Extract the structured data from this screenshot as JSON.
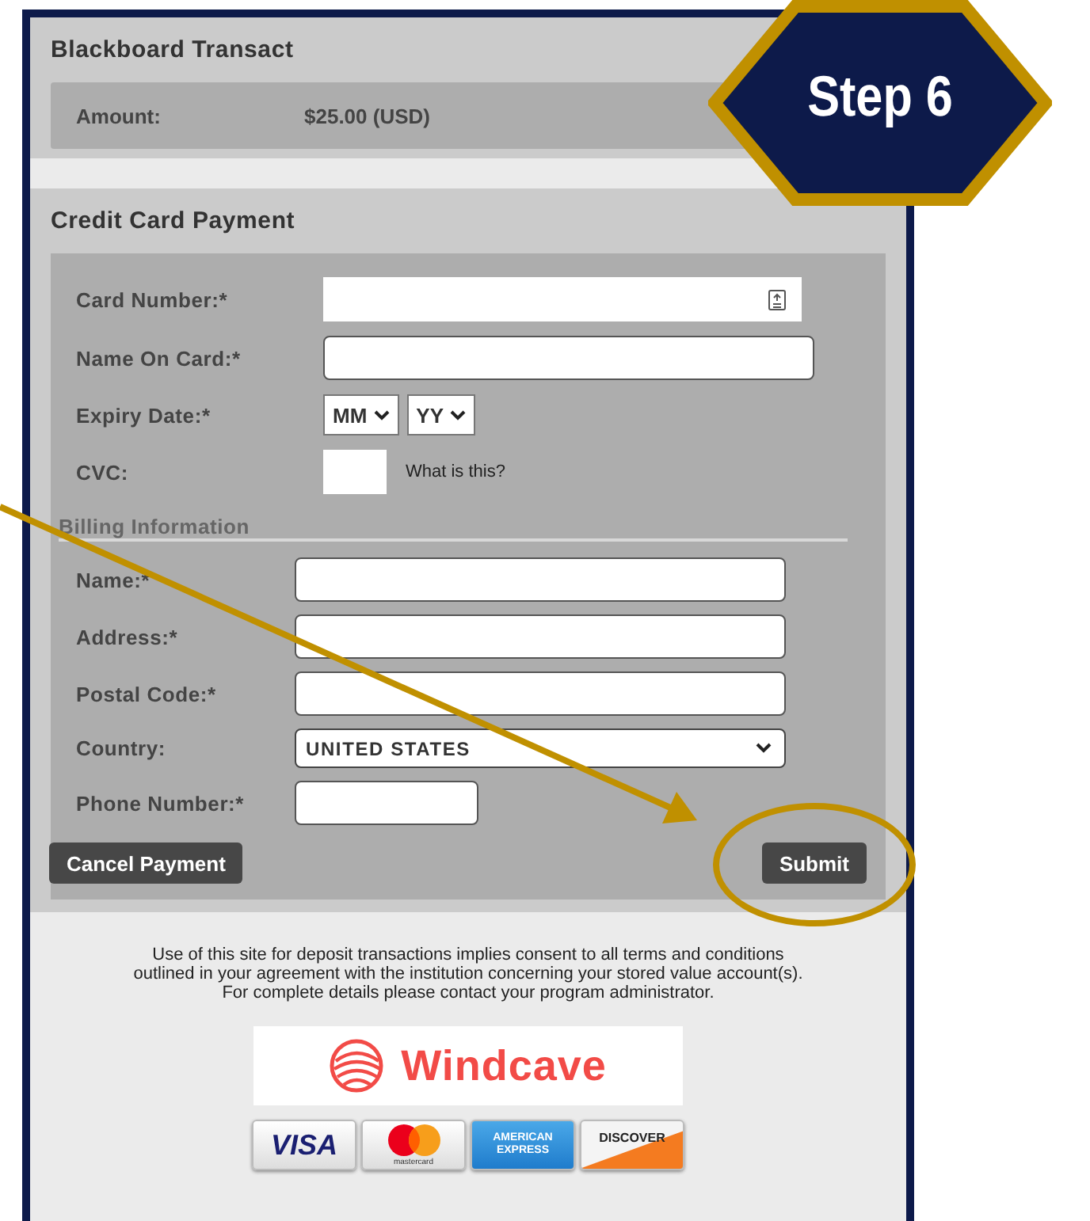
{
  "header": {
    "title": "Blackboard Transact",
    "amount_label": "Amount:",
    "amount": "$25.00 (USD)"
  },
  "step_badge": "Step 6",
  "payment": {
    "title": "Credit Card Payment",
    "card_fields": [
      {
        "label": "Card Number:*",
        "kind": "card"
      },
      {
        "label": "Name On Card:*",
        "kind": "text"
      },
      {
        "label": "Expiry Date:*",
        "kind": "expiry",
        "selects": [
          "MM",
          "YY"
        ]
      },
      {
        "label": "CVC:",
        "kind": "cvc",
        "help_link": "What is this?"
      }
    ],
    "billing": {
      "title": "Billing Information",
      "fields": [
        {
          "label": "Name:*",
          "kind": "text"
        },
        {
          "label": "Address:*",
          "kind": "text"
        },
        {
          "label": "Postal Code:*",
          "kind": "text"
        },
        {
          "label": "Country:",
          "kind": "select",
          "value": "UNITED STATES"
        },
        {
          "label": "Phone Number:*",
          "kind": "short"
        }
      ]
    },
    "buttons": [
      {
        "label": "Cancel Payment",
        "highlighted": false
      },
      {
        "label": "Submit",
        "highlighted": true
      }
    ]
  },
  "notice_lines": [
    "Use of this site for deposit transactions implies consent to all terms and conditions",
    "outlined in your agreement with the institution concerning your stored value account(s).",
    "For complete details please contact your program administrator."
  ],
  "payment_logos": {
    "brand": "Windcave",
    "cards": [
      {
        "kind": "visa",
        "label": "VISA"
      },
      {
        "kind": "mastercard",
        "label": "mastercard"
      },
      {
        "kind": "amex",
        "label": "AMERICAN EXPRESS"
      },
      {
        "kind": "discover",
        "label": "DISCOVER"
      }
    ]
  }
}
